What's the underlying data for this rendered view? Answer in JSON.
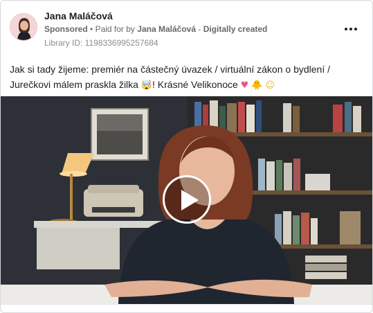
{
  "post": {
    "author_name": "Jana Maláčová",
    "sponsored_label": "Sponsored",
    "separator": "•",
    "paid_for_prefix": "Paid for by",
    "paid_for_name": "Jana Maláčová",
    "dash": "-",
    "created_label": "Digitally created",
    "library_id": "Library ID: 1198336995257684",
    "text_line1": "Jak si tady žijeme: premiér na částečný úvazek / virtuální zákon o bydlení /",
    "text_line2_part1": "Jurečkovi málem praskla žilka",
    "text_line2_part2": "! Krásné Velikonoce"
  },
  "icons": {
    "avatar": "avatar-portrait",
    "more": "more-horizontal-icon",
    "play": "play-icon",
    "emoji_1": "exploding-head-emoji",
    "emoji_2": "pink-heart-emoji",
    "emoji_3": "chick-emoji",
    "emoji_4": "smiling-face-emoji"
  },
  "colors": {
    "text_primary": "#1c1e21",
    "text_secondary": "#65676b",
    "text_tertiary": "#8a8d91",
    "video_bg": "#1e1f23"
  }
}
